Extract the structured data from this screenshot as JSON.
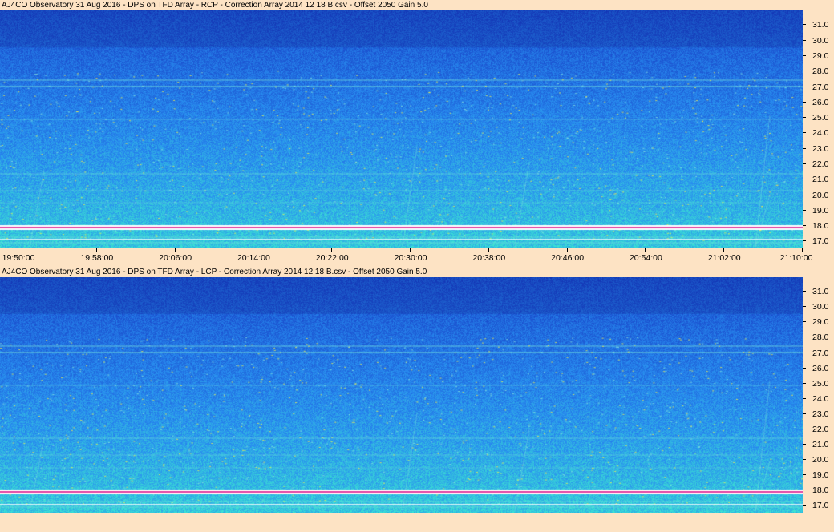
{
  "panels": [
    {
      "title": "AJ4CO Observatory 31 Aug 2016  -  DPS on TFD Array  -  RCP  -  Correction Array 2014 12 18 B.csv  -  Offset 2050  Gain 5.0",
      "polarization": "RCP"
    },
    {
      "title": "AJ4CO Observatory 31 Aug 2016  -  DPS on TFD Array  -  LCP  -  Correction Array 2014 12 18 B.csv  -  Offset 2050  Gain 5.0",
      "polarization": "LCP"
    }
  ],
  "freq_axis": {
    "unit_labels": [
      "31.0",
      "30.0",
      "29.0",
      "28.0",
      "27.0",
      "26.0",
      "25.0",
      "24.0",
      "23.0",
      "22.0",
      "21.0",
      "20.0",
      "19.0",
      "18.0",
      "17.0"
    ],
    "min": 16.5,
    "max": 31.9
  },
  "time_axis": {
    "labels": [
      "19:50:00",
      "19:58:00",
      "20:06:00",
      "20:14:00",
      "20:22:00",
      "20:30:00",
      "20:38:00",
      "20:46:00",
      "20:54:00",
      "21:02:00",
      "21:10:00"
    ]
  },
  "colors": {
    "background": "#fde3c4",
    "low": "#1a3fd0",
    "mid": "#2b8ff0",
    "high": "#3fe0d0",
    "hot": "#e8f040",
    "rfi": "#e040a0"
  }
}
